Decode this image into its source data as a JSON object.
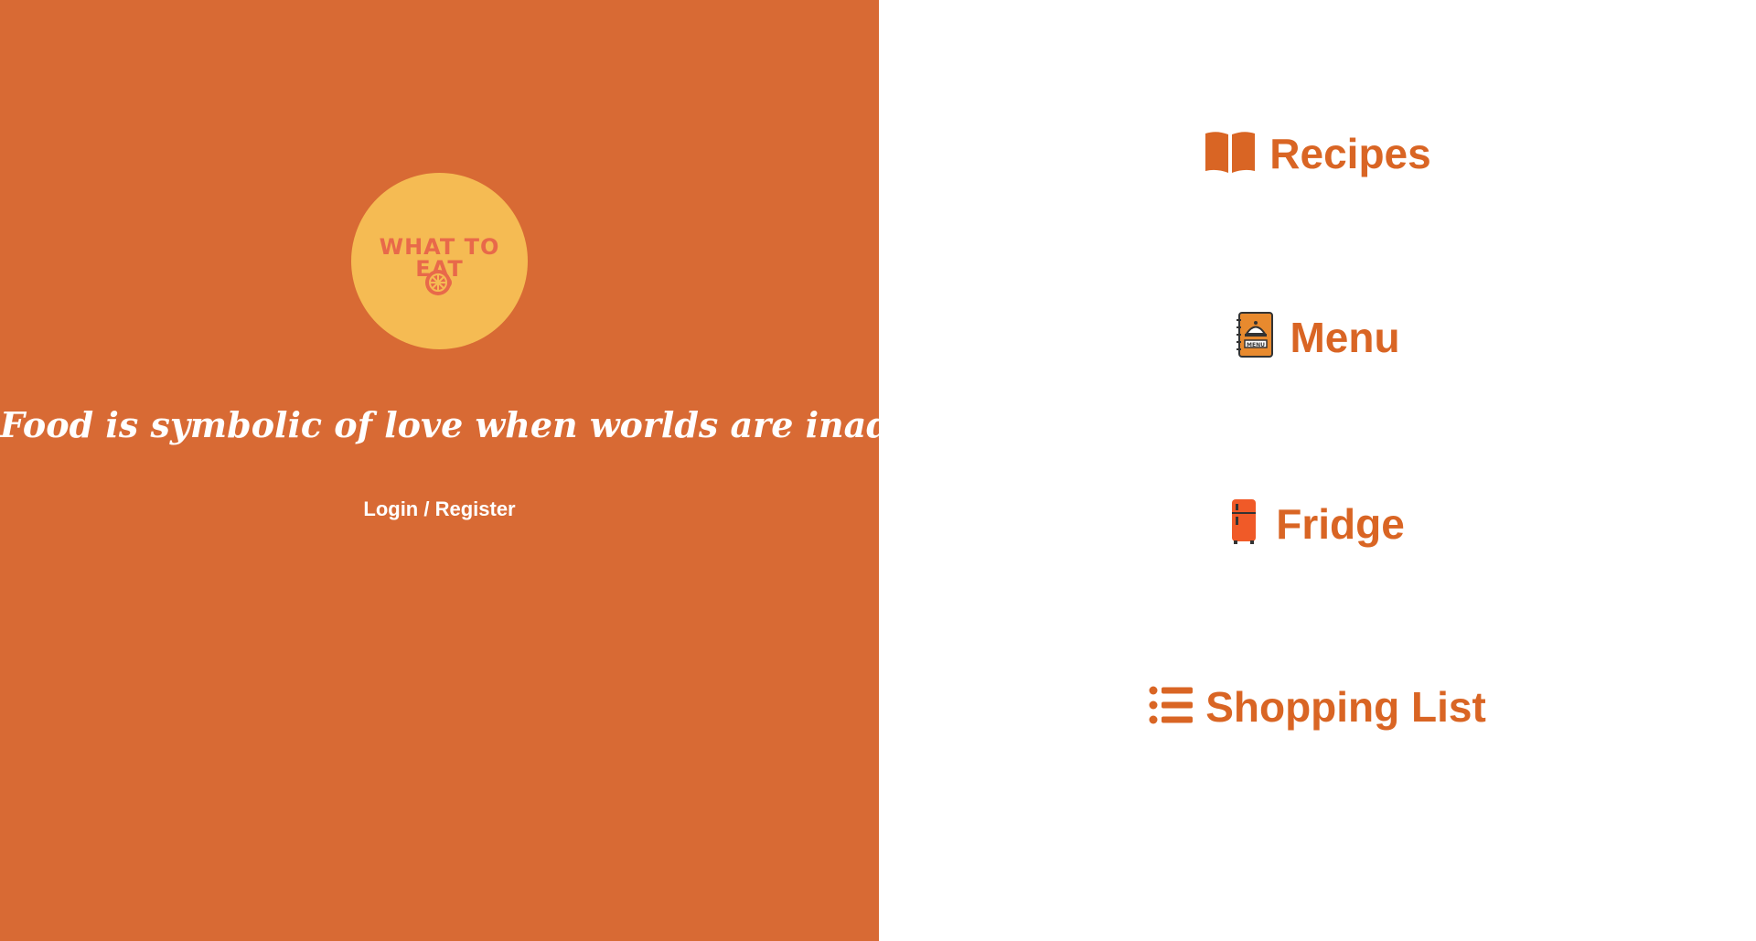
{
  "colors": {
    "left_bg": "#d86a34",
    "logo_circle": "#f5bb53",
    "logo_text": "#e8694a",
    "nav_text": "#d96524",
    "white": "#ffffff",
    "fridge_body": "#f05a28",
    "menu_book": "#e88a2e"
  },
  "logo": {
    "text": "WHAT TO EAT",
    "icon": "lemon-icon"
  },
  "tagline": "Food is symbolic of love when worlds are inadequate.",
  "auth": {
    "login_register_label": "Login / Register"
  },
  "nav": {
    "items": [
      {
        "label": "Recipes",
        "icon": "open-book-icon"
      },
      {
        "label": "Menu",
        "icon": "menu-book-icon"
      },
      {
        "label": "Fridge",
        "icon": "fridge-icon"
      },
      {
        "label": "Shopping List",
        "icon": "list-icon"
      }
    ]
  }
}
